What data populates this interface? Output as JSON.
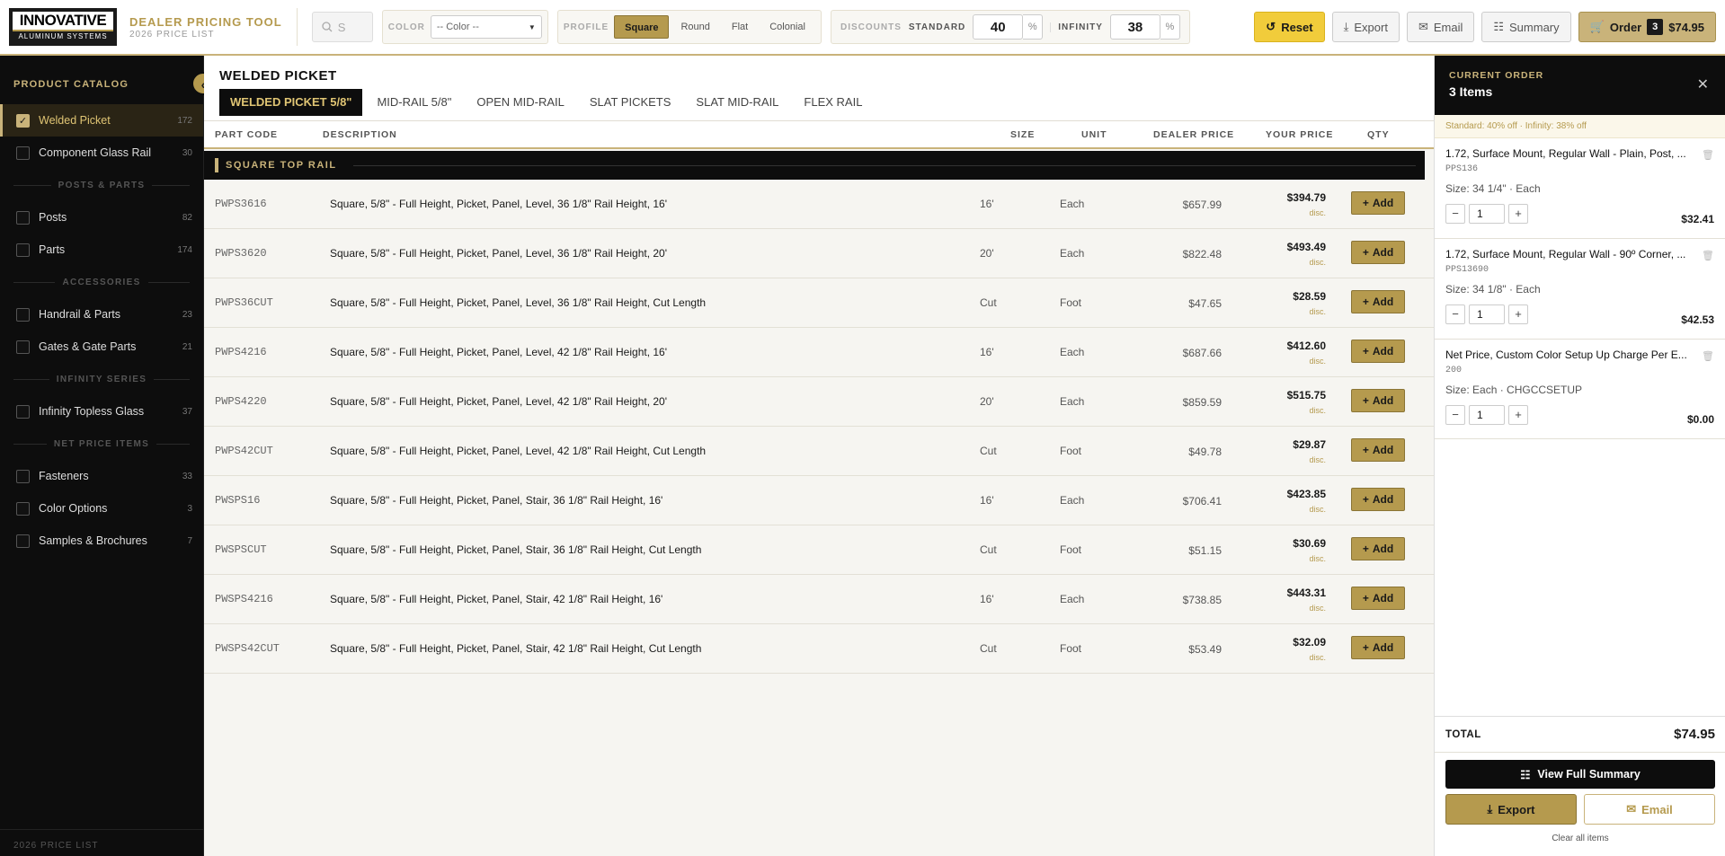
{
  "header": {
    "logo_main": "INNOVATIVE",
    "logo_sub": "ALUMINUM SYSTEMS",
    "app_title": "DEALER PRICING TOOL",
    "app_subtitle": "2026 PRICE LIST",
    "search_placeholder": "S",
    "color_label": "COLOR",
    "color_value": "-- Color --",
    "profile_label": "PROFILE",
    "profiles": [
      "Square",
      "Round",
      "Flat",
      "Colonial"
    ],
    "discounts_label": "DISCOUNTS",
    "standard_label": "STANDARD",
    "standard_value": "40",
    "infinity_label": "INFINITY",
    "infinity_value": "38",
    "pct": "%",
    "reset": "Reset",
    "export": "Export",
    "email": "Email",
    "summary": "Summary",
    "order": "Order",
    "order_count": "3",
    "order_total": "$74.95"
  },
  "sidebar": {
    "title": "PRODUCT CATALOG",
    "collapse": "‹",
    "footer": "2026 PRICE LIST",
    "items": [
      {
        "label": "Welded Picket",
        "count": "172"
      },
      {
        "label": "Component Glass Rail",
        "count": "30"
      },
      {
        "label": "Posts",
        "count": "82"
      },
      {
        "label": "Parts",
        "count": "174"
      },
      {
        "label": "Handrail & Parts",
        "count": "23"
      },
      {
        "label": "Gates & Gate Parts",
        "count": "21"
      },
      {
        "label": "Infinity Topless Glass",
        "count": "37"
      },
      {
        "label": "Fasteners",
        "count": "33"
      },
      {
        "label": "Color Options",
        "count": "3"
      },
      {
        "label": "Samples & Brochures",
        "count": "7"
      }
    ],
    "sections": [
      "POSTS & PARTS",
      "ACCESSORIES",
      "INFINITY SERIES",
      "NET PRICE ITEMS"
    ]
  },
  "main": {
    "title": "WELDED PICKET",
    "tabs": [
      "WELDED PICKET 5/8\"",
      "MID-RAIL 5/8\"",
      "OPEN MID-RAIL",
      "SLAT PICKETS",
      "SLAT MID-RAIL",
      "FLEX RAIL"
    ],
    "columns": {
      "code": "PART CODE",
      "desc": "DESCRIPTION",
      "size": "SIZE",
      "unit": "UNIT",
      "dealer": "DEALER PRICE",
      "your": "YOUR PRICE",
      "qty": "QTY"
    },
    "group": "SQUARE TOP RAIL",
    "disc": "disc.",
    "add": "Add",
    "rows": [
      {
        "code": "PWPS3616",
        "desc": "Square, 5/8\" - Full Height, Picket, Panel, Level, 36 1/8\" Rail Height, 16'",
        "size": "16'",
        "unit": "Each",
        "dealer": "$657.99",
        "your": "$394.79"
      },
      {
        "code": "PWPS3620",
        "desc": "Square, 5/8\" - Full Height, Picket, Panel, Level, 36 1/8\" Rail Height, 20'",
        "size": "20'",
        "unit": "Each",
        "dealer": "$822.48",
        "your": "$493.49"
      },
      {
        "code": "PWPS36CUT",
        "desc": "Square, 5/8\" - Full Height, Picket, Panel, Level, 36 1/8\" Rail Height, Cut Length",
        "size": "Cut",
        "unit": "Foot",
        "dealer": "$47.65",
        "your": "$28.59"
      },
      {
        "code": "PWPS4216",
        "desc": "Square, 5/8\" - Full Height, Picket, Panel, Level, 42 1/8\" Rail Height, 16'",
        "size": "16'",
        "unit": "Each",
        "dealer": "$687.66",
        "your": "$412.60"
      },
      {
        "code": "PWPS4220",
        "desc": "Square, 5/8\" - Full Height, Picket, Panel, Level, 42 1/8\" Rail Height, 20'",
        "size": "20'",
        "unit": "Each",
        "dealer": "$859.59",
        "your": "$515.75"
      },
      {
        "code": "PWPS42CUT",
        "desc": "Square, 5/8\" - Full Height, Picket, Panel, Level, 42 1/8\" Rail Height, Cut Length",
        "size": "Cut",
        "unit": "Foot",
        "dealer": "$49.78",
        "your": "$29.87"
      },
      {
        "code": "PWSPS16",
        "desc": "Square, 5/8\" - Full Height, Picket, Panel, Stair, 36 1/8\" Rail Height, 16'",
        "size": "16'",
        "unit": "Each",
        "dealer": "$706.41",
        "your": "$423.85"
      },
      {
        "code": "PWSPSCUT",
        "desc": "Square, 5/8\" - Full Height, Picket, Panel, Stair, 36 1/8\" Rail Height, Cut Length",
        "size": "Cut",
        "unit": "Foot",
        "dealer": "$51.15",
        "your": "$30.69"
      },
      {
        "code": "PWSPS4216",
        "desc": "Square, 5/8\" - Full Height, Picket, Panel, Stair, 42 1/8\" Rail Height, 16'",
        "size": "16'",
        "unit": "Each",
        "dealer": "$738.85",
        "your": "$443.31"
      },
      {
        "code": "PWSPS42CUT",
        "desc": "Square, 5/8\" - Full Height, Picket, Panel, Stair, 42 1/8\" Rail Height, Cut Length",
        "size": "Cut",
        "unit": "Foot",
        "dealer": "$53.49",
        "your": "$32.09"
      }
    ]
  },
  "cart": {
    "label": "CURRENT ORDER",
    "count_text": "3 Items",
    "note": "Standard: 40% off · Infinity: 38% off",
    "items": [
      {
        "name": "1.72, Surface Mount, Regular Wall - Plain, Post, ...",
        "code": "PPS136",
        "size": "Size: 34 1/4\" · Each",
        "qty": "1",
        "price": "$32.41"
      },
      {
        "name": "1.72, Surface Mount, Regular Wall - 90º Corner, ...",
        "code": "PPS13690",
        "size": "Size: 34 1/8\" · Each",
        "qty": "1",
        "price": "$42.53"
      },
      {
        "name": "Net Price, Custom Color Setup Up Charge Per E...",
        "code": "200",
        "size": "Size: Each · CHGCCSETUP",
        "qty": "1",
        "price": "$0.00"
      }
    ],
    "total_label": "TOTAL",
    "total": "$74.95",
    "view_summary": "View Full Summary",
    "export": "Export",
    "email": "Email",
    "clear": "Clear all items"
  }
}
